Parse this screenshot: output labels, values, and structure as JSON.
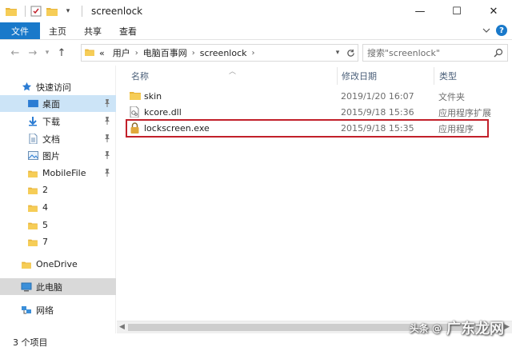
{
  "window": {
    "title": "screenlock",
    "controls": {
      "minimize": "—",
      "maximize": "☐",
      "close": "✕"
    }
  },
  "ribbon": {
    "tabs": [
      "文件",
      "主页",
      "共享",
      "查看"
    ],
    "help": "?"
  },
  "address": {
    "prefix": "«",
    "crumbs": [
      "用户",
      "电脑百事网",
      "screenlock"
    ],
    "search_placeholder": "搜索\"screenlock\""
  },
  "navpane": {
    "quick_access": "快速访问",
    "items": [
      {
        "label": "桌面",
        "icon": "desktop-icon",
        "pinned": true
      },
      {
        "label": "下载",
        "icon": "download-icon",
        "pinned": true
      },
      {
        "label": "文档",
        "icon": "document-icon",
        "pinned": true
      },
      {
        "label": "图片",
        "icon": "picture-icon",
        "pinned": true
      },
      {
        "label": "MobileFile",
        "icon": "folder-icon",
        "pinned": true
      },
      {
        "label": "2",
        "icon": "folder-icon",
        "pinned": false
      },
      {
        "label": "4",
        "icon": "folder-icon",
        "pinned": false
      },
      {
        "label": "5",
        "icon": "folder-icon",
        "pinned": false
      },
      {
        "label": "7",
        "icon": "folder-icon",
        "pinned": false
      }
    ],
    "onedrive": "OneDrive",
    "this_pc": "此电脑",
    "network": "网络"
  },
  "columns": {
    "name": "名称",
    "date": "修改日期",
    "type": "类型"
  },
  "files": [
    {
      "name": "skin",
      "date": "2019/1/20 16:07",
      "type": "文件夹",
      "icon": "folder-icon"
    },
    {
      "name": "kcore.dll",
      "date": "2015/9/18 15:36",
      "type": "应用程序扩展",
      "icon": "dll-file-icon"
    },
    {
      "name": "lockscreen.exe",
      "date": "2015/9/18 15:35",
      "type": "应用程序",
      "icon": "lock-exe-icon"
    }
  ],
  "status": {
    "count": "3 个项目"
  },
  "watermark": {
    "prefix": "头条 @",
    "text": "广东龙网"
  },
  "colors": {
    "accent": "#1979ca",
    "highlight": "#c2202a",
    "folder": "#e8b53c"
  }
}
